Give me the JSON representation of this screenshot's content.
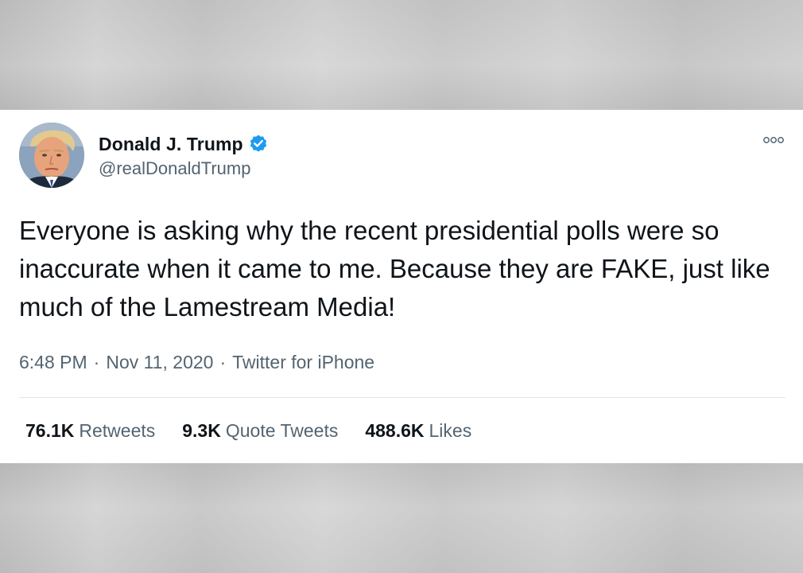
{
  "user": {
    "display_name": "Donald J. Trump",
    "handle": "@realDonaldTrump",
    "verified": true
  },
  "tweet": {
    "text": "Everyone is asking why the recent presidential polls were so inaccurate when it came to me. Because they are FAKE, just like much of the Lamestream Media!",
    "time": "6:48 PM",
    "separator": "·",
    "date": "Nov 11, 2020",
    "source": "Twitter for iPhone"
  },
  "stats": {
    "retweets_count": "76.1K",
    "retweets_label": "Retweets",
    "quotes_count": "9.3K",
    "quotes_label": "Quote Tweets",
    "likes_count": "488.6K",
    "likes_label": "Likes"
  },
  "icons": {
    "more": "more-options-icon",
    "verified": "verified-badge-icon"
  },
  "colors": {
    "verified_blue": "#1d9bf0",
    "primary_text": "#0f1419",
    "secondary_text": "#536471"
  }
}
